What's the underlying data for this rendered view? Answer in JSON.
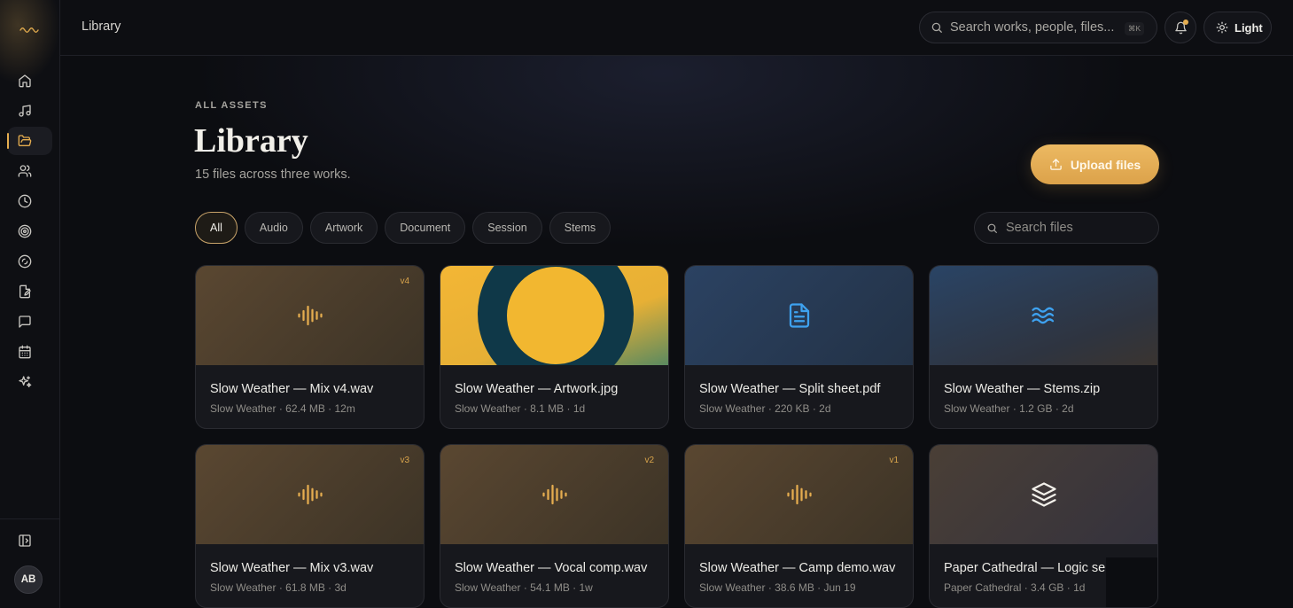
{
  "topbar": {
    "breadcrumb": "Library",
    "search_placeholder": "Search works, people, files...",
    "shortcut": "⌘K",
    "theme_label": "Light"
  },
  "sidebar": {
    "items": [
      {
        "name": "home-icon"
      },
      {
        "name": "music-icon"
      },
      {
        "name": "folder-open-icon",
        "active": true
      },
      {
        "name": "users-icon"
      },
      {
        "name": "clock-icon"
      },
      {
        "name": "target-icon"
      },
      {
        "name": "disc-icon"
      },
      {
        "name": "edit-file-icon"
      },
      {
        "name": "message-icon"
      },
      {
        "name": "calendar-icon"
      },
      {
        "name": "sparkles-icon"
      }
    ],
    "avatar_initials": "AB"
  },
  "page": {
    "eyebrow": "ALL ASSETS",
    "title": "Library",
    "subtitle": "15 files across three works.",
    "upload_label": "Upload files",
    "file_search_placeholder": "Search files"
  },
  "filters": [
    "All",
    "Audio",
    "Artwork",
    "Document",
    "Session",
    "Stems"
  ],
  "active_filter": "All",
  "files": [
    {
      "name": "Slow Weather — Mix v4.wav",
      "meta": "Slow Weather · 62.4 MB · 12m",
      "type": "audio",
      "version": "v4"
    },
    {
      "name": "Slow Weather — Artwork.jpg",
      "meta": "Slow Weather · 8.1 MB · 1d",
      "type": "artwork",
      "version": ""
    },
    {
      "name": "Slow Weather — Split sheet.pdf",
      "meta": "Slow Weather · 220 KB · 2d",
      "type": "document",
      "version": ""
    },
    {
      "name": "Slow Weather — Stems.zip",
      "meta": "Slow Weather · 1.2 GB · 2d",
      "type": "stems",
      "version": ""
    },
    {
      "name": "Slow Weather — Mix v3.wav",
      "meta": "Slow Weather · 61.8 MB · 3d",
      "type": "audio",
      "version": "v3"
    },
    {
      "name": "Slow Weather — Vocal comp.wav",
      "meta": "Slow Weather · 54.1 MB · 1w",
      "type": "audio",
      "version": "v2"
    },
    {
      "name": "Slow Weather — Camp demo.wav",
      "meta": "Slow Weather · 38.6 MB · Jun 19",
      "type": "audio",
      "version": "v1"
    },
    {
      "name": "Paper Cathedral — Logic se",
      "meta": "Paper Cathedral · 3.4 GB · 1d",
      "type": "session",
      "version": ""
    }
  ],
  "colors": {
    "accent": "#e5ad4f",
    "background": "#0c0d11",
    "doc_icon": "#3ea2f0"
  }
}
